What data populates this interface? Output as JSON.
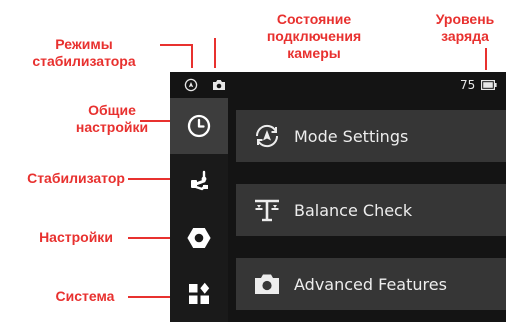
{
  "callouts": {
    "stab_modes": "Режимы\nстабилизатора",
    "camera_status": "Состояние подключения\nкамеры",
    "battery": "Уровень\nзаряда",
    "general": "Общие\nнастройки",
    "gimbal": "Стабилизатор",
    "settings": "Настройки",
    "system": "Система"
  },
  "status_bar": {
    "battery_level": "75",
    "icons": [
      "gimbal-mode-icon",
      "camera-icon",
      "battery-icon"
    ]
  },
  "sidebar": {
    "items": [
      {
        "icon": "clock-icon",
        "active": true
      },
      {
        "icon": "gimbal-icon",
        "active": false
      },
      {
        "icon": "hexagon-icon",
        "active": false
      },
      {
        "icon": "grid-icon",
        "active": false
      }
    ]
  },
  "menu": {
    "items": [
      {
        "label": "Mode Settings",
        "icon": "mode-icon"
      },
      {
        "label": "Balance Check",
        "icon": "balance-icon"
      },
      {
        "label": "Advanced Features",
        "icon": "camera-icon"
      }
    ]
  },
  "colors": {
    "accent": "#e8312f",
    "screen_bg": "#141414",
    "card_bg": "#363636",
    "active_nav": "#3d3d3d"
  }
}
